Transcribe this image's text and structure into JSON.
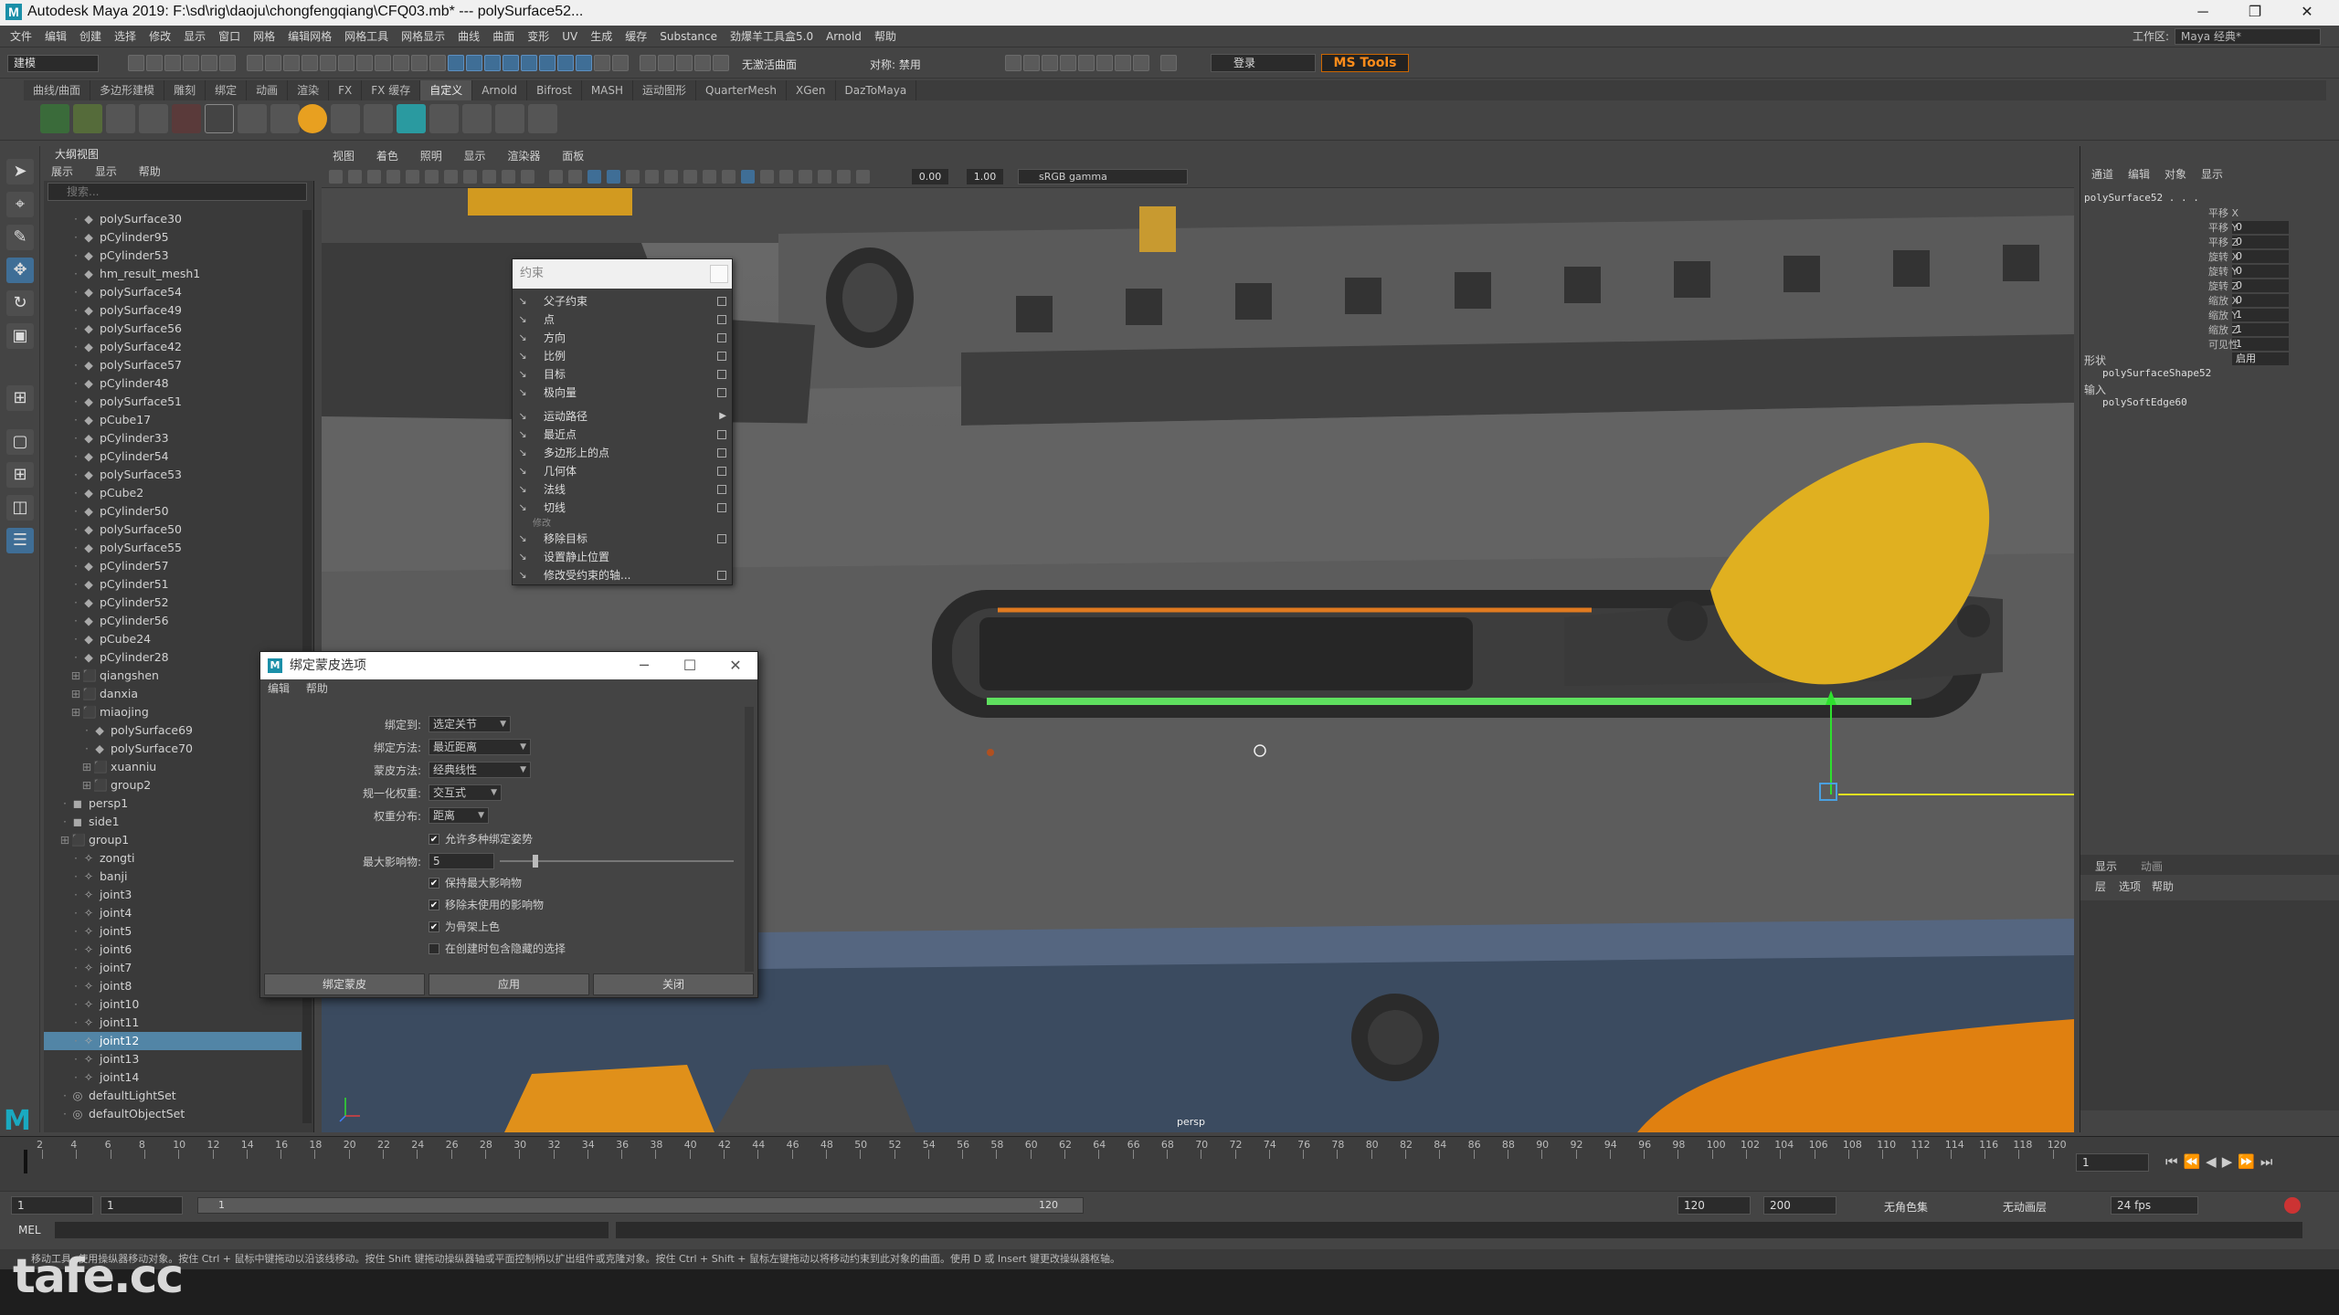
{
  "title": "Autodesk Maya 2019: F:\\sd\\rig\\daoju\\chongfengqiang\\CFQ03.mb*   ---   polySurface52...",
  "menu": [
    "文件",
    "编辑",
    "创建",
    "选择",
    "修改",
    "显示",
    "窗口",
    "网格",
    "编辑网格",
    "网格工具",
    "网格显示",
    "曲线",
    "曲面",
    "变形",
    "UV",
    "生成",
    "缓存",
    "Substance",
    "劲爆羊工具盒5.0",
    "Arnold",
    "帮助"
  ],
  "workspace_label": "工作区:",
  "workspace_value": "Maya 经典*",
  "mode": "建模",
  "status": {
    "no_live": "无激活曲面",
    "symmetry": "对称: 禁用",
    "login": "登录",
    "mstools": "MS Tools"
  },
  "shelf_tabs": [
    "曲线/曲面",
    "多边形建模",
    "雕刻",
    "绑定",
    "动画",
    "渲染",
    "FX",
    "FX 缓存",
    "自定义",
    "Arnold",
    "Bifrost",
    "MASH",
    "运动图形",
    "QuarterMesh",
    "XGen",
    "DazToMaya"
  ],
  "shelf_active": "自定义",
  "outliner": {
    "header": "大纲视图",
    "menu": [
      "展示",
      "显示",
      "帮助"
    ],
    "search": "搜索..."
  },
  "tree": [
    {
      "t": "polySurface30",
      "i": "mesh",
      "d": 1
    },
    {
      "t": "pCylinder95",
      "i": "mesh",
      "d": 1
    },
    {
      "t": "pCylinder53",
      "i": "mesh",
      "d": 1
    },
    {
      "t": "hm_result_mesh1",
      "i": "mesh",
      "d": 1
    },
    {
      "t": "polySurface54",
      "i": "mesh",
      "d": 1
    },
    {
      "t": "polySurface49",
      "i": "mesh",
      "d": 1
    },
    {
      "t": "polySurface56",
      "i": "mesh",
      "d": 1
    },
    {
      "t": "polySurface42",
      "i": "mesh",
      "d": 1
    },
    {
      "t": "polySurface57",
      "i": "mesh",
      "d": 1
    },
    {
      "t": "pCylinder48",
      "i": "mesh",
      "d": 1
    },
    {
      "t": "polySurface51",
      "i": "mesh",
      "d": 1
    },
    {
      "t": "pCube17",
      "i": "mesh",
      "d": 1
    },
    {
      "t": "pCylinder33",
      "i": "mesh",
      "d": 1
    },
    {
      "t": "pCylinder54",
      "i": "mesh",
      "d": 1
    },
    {
      "t": "polySurface53",
      "i": "mesh",
      "d": 1
    },
    {
      "t": "pCube2",
      "i": "mesh",
      "d": 1
    },
    {
      "t": "pCylinder50",
      "i": "mesh",
      "d": 1
    },
    {
      "t": "polySurface50",
      "i": "mesh",
      "d": 1
    },
    {
      "t": "polySurface55",
      "i": "mesh",
      "d": 1
    },
    {
      "t": "pCylinder57",
      "i": "mesh",
      "d": 1
    },
    {
      "t": "pCylinder51",
      "i": "mesh",
      "d": 1
    },
    {
      "t": "pCylinder52",
      "i": "mesh",
      "d": 1
    },
    {
      "t": "pCylinder56",
      "i": "mesh",
      "d": 1
    },
    {
      "t": "pCube24",
      "i": "mesh",
      "d": 1
    },
    {
      "t": "pCylinder28",
      "i": "mesh",
      "d": 1
    },
    {
      "t": "qiangshen",
      "i": "group",
      "d": 1
    },
    {
      "t": "danxia",
      "i": "group",
      "d": 1
    },
    {
      "t": "miaojing",
      "i": "group",
      "d": 1
    },
    {
      "t": "polySurface69",
      "i": "mesh",
      "d": 2
    },
    {
      "t": "polySurface70",
      "i": "mesh",
      "d": 2
    },
    {
      "t": "xuanniu",
      "i": "group",
      "d": 2
    },
    {
      "t": "group2",
      "i": "group",
      "d": 2
    },
    {
      "t": "persp1",
      "i": "cam",
      "d": 0
    },
    {
      "t": "side1",
      "i": "cam",
      "d": 0
    },
    {
      "t": "group1",
      "i": "group",
      "d": 0
    },
    {
      "t": "zongti",
      "i": "joint",
      "d": 1
    },
    {
      "t": "banji",
      "i": "joint",
      "d": 1
    },
    {
      "t": "joint3",
      "i": "joint",
      "d": 1
    },
    {
      "t": "joint4",
      "i": "joint",
      "d": 1
    },
    {
      "t": "joint5",
      "i": "joint",
      "d": 1
    },
    {
      "t": "joint6",
      "i": "joint",
      "d": 1
    },
    {
      "t": "joint7",
      "i": "joint",
      "d": 1
    },
    {
      "t": "joint8",
      "i": "joint",
      "d": 1
    },
    {
      "t": "joint10",
      "i": "joint",
      "d": 1
    },
    {
      "t": "joint11",
      "i": "joint",
      "d": 1
    },
    {
      "t": "joint12",
      "i": "joint",
      "d": 1,
      "sel": true
    },
    {
      "t": "joint13",
      "i": "joint",
      "d": 1
    },
    {
      "t": "joint14",
      "i": "joint",
      "d": 1
    },
    {
      "t": "defaultLightSet",
      "i": "set",
      "d": 0
    },
    {
      "t": "defaultObjectSet",
      "i": "set",
      "d": 0
    }
  ],
  "viewport": {
    "menu": [
      "视图",
      "着色",
      "照明",
      "显示",
      "渲染器",
      "面板"
    ],
    "val1": "0.00",
    "val2": "1.00",
    "gamma": "sRGB gamma",
    "camera": "persp"
  },
  "constraint_menu": {
    "title": "约束",
    "items": [
      {
        "l": "父子约束",
        "c": true
      },
      {
        "l": "点",
        "c": true
      },
      {
        "l": "方向",
        "c": true
      },
      {
        "l": "比例",
        "c": true
      },
      {
        "l": "目标",
        "c": true
      },
      {
        "l": "极向量",
        "c": true
      },
      {
        "l": "运动路径",
        "arrow": true,
        "gap": true
      },
      {
        "l": "最近点",
        "c": true
      },
      {
        "l": "多边形上的点",
        "c": true
      },
      {
        "l": "几何体",
        "c": true
      },
      {
        "l": "法线",
        "c": true
      },
      {
        "l": "切线",
        "c": true
      },
      {
        "l": "移除目标",
        "c": true,
        "gap": true
      },
      {
        "l": "设置静止位置",
        "c": false
      },
      {
        "l": "修改受约束的轴...",
        "c": true
      }
    ],
    "section": "修改"
  },
  "dialog": {
    "title": "绑定蒙皮选项",
    "menu": [
      "编辑",
      "帮助"
    ],
    "fields": [
      {
        "label": "绑定到:",
        "value": "选定关节"
      },
      {
        "label": "绑定方法:",
        "value": "最近距离"
      },
      {
        "label": "蒙皮方法:",
        "value": "经典线性"
      },
      {
        "label": "规一化权重:",
        "value": "交互式"
      },
      {
        "label": "权重分布:",
        "value": "距离"
      }
    ],
    "allow_multi": "允许多种绑定姿势",
    "max_inf_label": "最大影响物:",
    "max_inf_value": "5",
    "checks": [
      "保持最大影响物",
      "移除未使用的影响物",
      "为骨架上色",
      "在创建时包含隐藏的选择"
    ],
    "checks_state": [
      true,
      true,
      true,
      false
    ],
    "buttons": [
      "绑定蒙皮",
      "应用",
      "关闭"
    ]
  },
  "attr": {
    "tabs": [
      "通道",
      "编辑",
      "对象",
      "显示"
    ],
    "node": "polySurface52 . . .",
    "channels": [
      {
        "n": "平移 X",
        "v": "0"
      },
      {
        "n": "平移 Y",
        "v": "0"
      },
      {
        "n": "平移 Z",
        "v": "0"
      },
      {
        "n": "旋转 X",
        "v": "0"
      },
      {
        "n": "旋转 Y",
        "v": "0"
      },
      {
        "n": "旋转 Z",
        "v": "0"
      },
      {
        "n": "缩放 X",
        "v": "1"
      },
      {
        "n": "缩放 Y",
        "v": "1"
      },
      {
        "n": "缩放 Z",
        "v": "1"
      },
      {
        "n": "可见性",
        "v": "启用"
      }
    ],
    "shapes": "形状",
    "shape_node": "polySurfaceShape52",
    "inputs": "输入",
    "input_node": "polySoftEdge60",
    "layer_tabs": [
      "显示",
      "动画"
    ],
    "layer_menu": [
      "层",
      "选项",
      "帮助"
    ]
  },
  "timeline": {
    "ticks": [
      "2",
      "4",
      "6",
      "8",
      "10",
      "12",
      "14",
      "16",
      "18",
      "20",
      "22",
      "24",
      "26",
      "28",
      "30",
      "32",
      "34",
      "36",
      "38",
      "40",
      "42",
      "44",
      "46",
      "48",
      "50",
      "52",
      "54",
      "56",
      "58",
      "60",
      "62",
      "64",
      "66",
      "68",
      "70",
      "72",
      "74",
      "76",
      "78",
      "80",
      "82",
      "84",
      "86",
      "88",
      "90",
      "92",
      "94",
      "96",
      "98",
      "100",
      "102",
      "104",
      "106",
      "108",
      "110",
      "112",
      "114",
      "116",
      "118",
      "120"
    ],
    "current": "1"
  },
  "range": {
    "start": "1",
    "start2": "1",
    "inner_start": "1",
    "inner_end": "120",
    "end": "120",
    "end2": "200",
    "char": "无角色集",
    "anim": "无动画层",
    "fps": "24 fps"
  },
  "cmd": "MEL",
  "help": "移动工具: 使用操纵器移动对象。按住 Ctrl + 鼠标中键拖动以沿该线移动。按住 Shift 键拖动操纵器轴或平面控制柄以扩出组件或克隆对象。按住 Ctrl + Shift + 鼠标左键拖动以将移动约束到此对象的曲面。使用 D 或 Insert 键更改操纵器枢轴。",
  "watermark": "tafe.cc"
}
